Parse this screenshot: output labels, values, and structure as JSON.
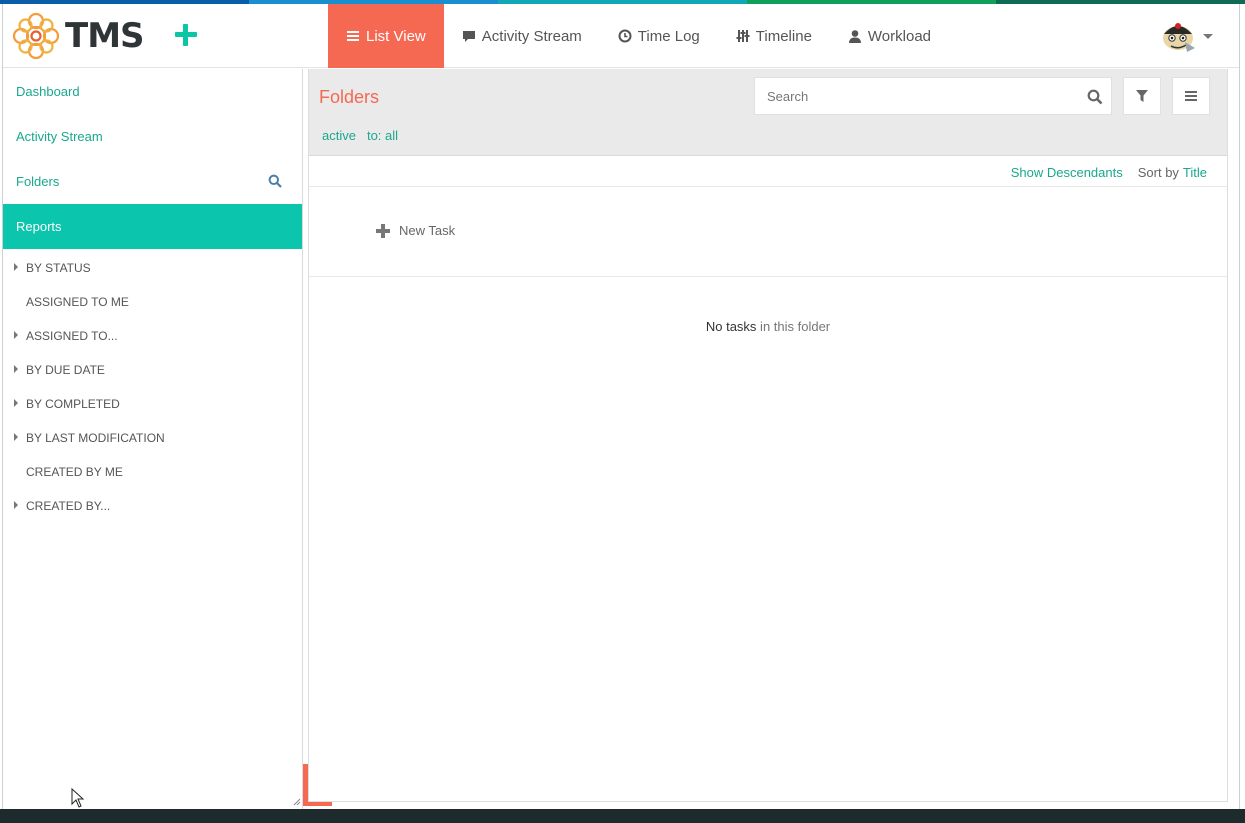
{
  "app": {
    "logo_text": "TMS",
    "strip_colors": [
      "#0a5ea8",
      "#1a8fcf",
      "#12a7b8",
      "#11a05a",
      "#0e6b55"
    ]
  },
  "nav": {
    "items": [
      {
        "label": "List View",
        "icon": "list-icon",
        "active": true
      },
      {
        "label": "Activity Stream",
        "icon": "comment-icon",
        "active": false
      },
      {
        "label": "Time Log",
        "icon": "clock-icon",
        "active": false
      },
      {
        "label": "Timeline",
        "icon": "sliders-icon",
        "active": false
      },
      {
        "label": "Workload",
        "icon": "user-icon",
        "active": false
      }
    ]
  },
  "sidebar": {
    "links": [
      {
        "label": "Dashboard"
      },
      {
        "label": "Activity Stream"
      },
      {
        "label": "Folders"
      },
      {
        "label": "Reports"
      }
    ],
    "reports": [
      {
        "label": "BY STATUS",
        "expandable": true
      },
      {
        "label": "ASSIGNED TO ME",
        "expandable": false
      },
      {
        "label": "ASSIGNED TO...",
        "expandable": true
      },
      {
        "label": "BY DUE DATE",
        "expandable": true
      },
      {
        "label": "BY COMPLETED",
        "expandable": true
      },
      {
        "label": "BY LAST MODIFICATION",
        "expandable": true
      },
      {
        "label": "CREATED BY ME",
        "expandable": false
      },
      {
        "label": "CREATED BY...",
        "expandable": true
      }
    ]
  },
  "main": {
    "title": "Folders",
    "search_placeholder": "Search",
    "filters": [
      "active",
      "to: all"
    ],
    "show_descendants": "Show Descendants",
    "sort_label": "Sort by",
    "sort_value": "Title",
    "new_task": "New Task",
    "empty_bold": "No tasks",
    "empty_rest": " in this folder"
  },
  "colors": {
    "accent": "#f56953",
    "teal": "#0bc5ad"
  }
}
